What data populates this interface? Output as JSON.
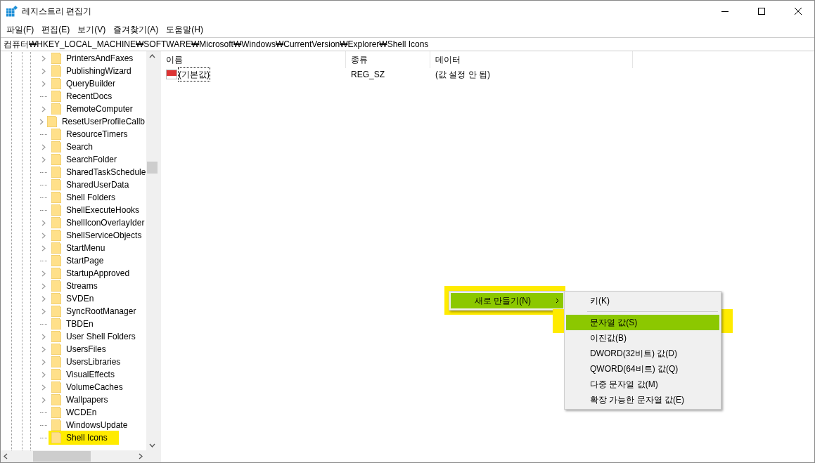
{
  "window": {
    "title": "레지스트리 편집기"
  },
  "menu": [
    "파일(F)",
    "편집(E)",
    "보기(V)",
    "즐겨찾기(A)",
    "도움말(H)"
  ],
  "address": "컴퓨터₩HKEY_LOCAL_MACHINE₩SOFTWARE₩Microsoft₩Windows₩CurrentVersion₩Explorer₩Shell Icons",
  "tree": [
    {
      "label": "PrintersAndFaxes",
      "expandable": true,
      "selected": false
    },
    {
      "label": "PublishingWizard",
      "expandable": true,
      "selected": false
    },
    {
      "label": "QueryBuilder",
      "expandable": true,
      "selected": false
    },
    {
      "label": "RecentDocs",
      "expandable": false,
      "selected": false
    },
    {
      "label": "RemoteComputer",
      "expandable": true,
      "selected": false
    },
    {
      "label": "ResetUserProfileCallb",
      "expandable": true,
      "selected": false
    },
    {
      "label": "ResourceTimers",
      "expandable": false,
      "selected": false
    },
    {
      "label": "Search",
      "expandable": true,
      "selected": false
    },
    {
      "label": "SearchFolder",
      "expandable": true,
      "selected": false
    },
    {
      "label": "SharedTaskSchedule",
      "expandable": false,
      "selected": false
    },
    {
      "label": "SharedUserData",
      "expandable": false,
      "selected": false
    },
    {
      "label": "Shell Folders",
      "expandable": false,
      "selected": false
    },
    {
      "label": "ShellExecuteHooks",
      "expandable": false,
      "selected": false
    },
    {
      "label": "ShellIconOverlayIder",
      "expandable": true,
      "selected": false
    },
    {
      "label": "ShellServiceObjects",
      "expandable": true,
      "selected": false
    },
    {
      "label": "StartMenu",
      "expandable": true,
      "selected": false
    },
    {
      "label": "StartPage",
      "expandable": false,
      "selected": false
    },
    {
      "label": "StartupApproved",
      "expandable": true,
      "selected": false
    },
    {
      "label": "Streams",
      "expandable": true,
      "selected": false
    },
    {
      "label": "SVDEn",
      "expandable": true,
      "selected": false
    },
    {
      "label": "SyncRootManager",
      "expandable": true,
      "selected": false
    },
    {
      "label": "TBDEn",
      "expandable": false,
      "selected": false
    },
    {
      "label": "User Shell Folders",
      "expandable": true,
      "selected": false
    },
    {
      "label": "UsersFiles",
      "expandable": true,
      "selected": false
    },
    {
      "label": "UsersLibraries",
      "expandable": true,
      "selected": false
    },
    {
      "label": "VisualEffects",
      "expandable": true,
      "selected": false
    },
    {
      "label": "VolumeCaches",
      "expandable": true,
      "selected": false
    },
    {
      "label": "Wallpapers",
      "expandable": true,
      "selected": false
    },
    {
      "label": "WCDEn",
      "expandable": false,
      "selected": false
    },
    {
      "label": "WindowsUpdate",
      "expandable": false,
      "selected": false
    },
    {
      "label": "Shell Icons",
      "expandable": false,
      "selected": true
    }
  ],
  "values": {
    "columns": [
      "이름",
      "종류",
      "데이터"
    ],
    "rows": [
      {
        "name": "(기본값)",
        "type": "REG_SZ",
        "data": "(값 설정 안 됨)"
      }
    ]
  },
  "context_menu": [
    {
      "label": "새로 만들기(N)",
      "selected": true,
      "submenu": true
    }
  ],
  "submenu": [
    {
      "kind": "item",
      "label": "키(K)",
      "selected": false
    },
    {
      "kind": "separator"
    },
    {
      "kind": "item",
      "label": "문자열 값(S)",
      "selected": true
    },
    {
      "kind": "item",
      "label": "이진값(B)",
      "selected": false
    },
    {
      "kind": "item",
      "label": "DWORD(32비트) 값(D)",
      "selected": false
    },
    {
      "kind": "item",
      "label": "QWORD(64비트) 값(Q)",
      "selected": false
    },
    {
      "kind": "item",
      "label": "다중 문자열 값(M)",
      "selected": false
    },
    {
      "kind": "item",
      "label": "확장 가능한 문자열 값(E)",
      "selected": false
    }
  ]
}
